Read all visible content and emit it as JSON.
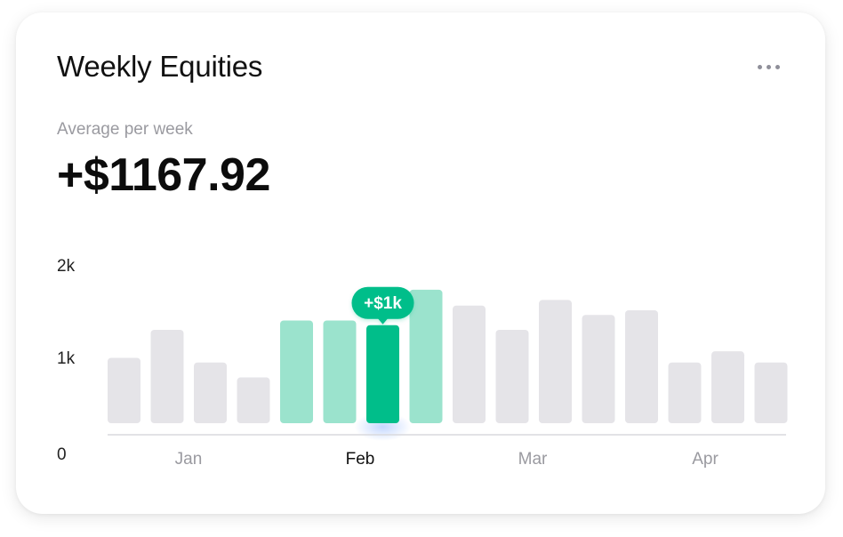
{
  "card": {
    "title": "Weekly Equities",
    "subtitle": "Average per week",
    "value": "+$1167.92",
    "menu_icon": "more-horizontal-icon"
  },
  "colors": {
    "bar_default": "#e5e4e8",
    "bar_light_green": "#9be3cd",
    "bar_active": "#00be8a",
    "tooltip_bg": "#00be8a",
    "axis_line": "#d9d9de",
    "label_muted": "#9a9aa0",
    "label_dark": "#111111"
  },
  "chart_data": {
    "type": "bar",
    "y_ticks": [
      "2k",
      "1k",
      "0"
    ],
    "ylim": [
      0,
      2000
    ],
    "x_labels": [
      "Jan",
      "Feb",
      "Mar",
      "Apr"
    ],
    "active_x_label": "Feb",
    "values": [
      700,
      1000,
      650,
      490,
      1100,
      1100,
      1050,
      1430,
      1260,
      1000,
      1320,
      1160,
      1210,
      650,
      770,
      650
    ],
    "highlight": [
      "default",
      "default",
      "default",
      "default",
      "light",
      "light",
      "active",
      "light",
      "default",
      "default",
      "default",
      "default",
      "default",
      "default",
      "default",
      "default"
    ],
    "tooltip": {
      "text": "+$1k"
    },
    "grid": false,
    "legend": "none"
  }
}
